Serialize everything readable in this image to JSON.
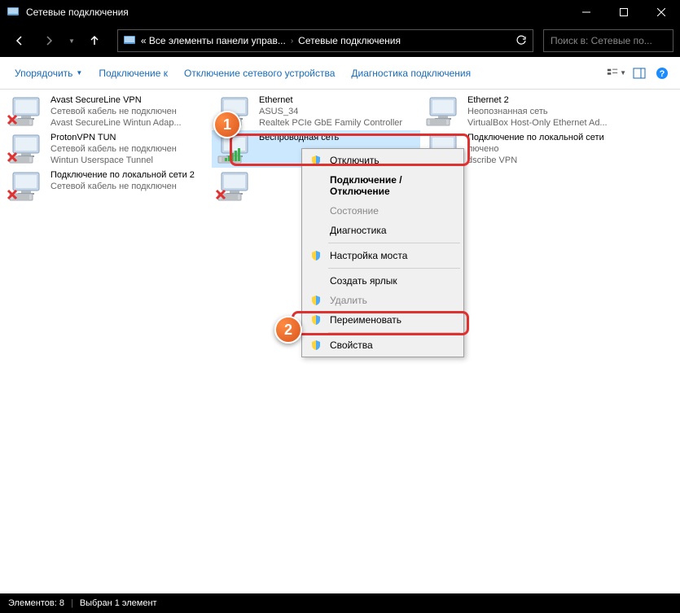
{
  "window": {
    "title": "Сетевые подключения"
  },
  "breadcrumb": {
    "part1": "« Все элементы панели управ...",
    "part2": "Сетевые подключения"
  },
  "search": {
    "placeholder": "Поиск в: Сетевые по..."
  },
  "toolbar": {
    "organize": "Упорядочить",
    "connect": "Подключение к",
    "disable": "Отключение сетевого устройства",
    "diagnose": "Диагностика подключения"
  },
  "connections": [
    {
      "name": "Avast SecureLine VPN",
      "status": "Сетевой кабель не подключен",
      "device": "Avast SecureLine Wintun Adap...",
      "x": true
    },
    {
      "name": "Ethernet",
      "status": "ASUS_34",
      "device": "Realtek PCIe GbE Family Controller",
      "x": false
    },
    {
      "name": "Ethernet 2",
      "status": "Неопознанная сеть",
      "device": "VirtualBox Host-Only Ethernet Ad...",
      "x": false
    },
    {
      "name": "ProtonVPN TUN",
      "status": "Сетевой кабель не подключен",
      "device": "Wintun Userspace Tunnel",
      "x": true
    },
    {
      "name": "Беспроводная сеть",
      "status": "",
      "device": "",
      "x": false,
      "selected": true,
      "signal": true
    },
    {
      "name": "Подключение по локальной сети",
      "status": "лючено",
      "device": "dscribe VPN",
      "x": false
    },
    {
      "name": "Подключение по локальной сети 2",
      "status": "Сетевой кабель не подключен",
      "device": "",
      "x": true
    },
    {
      "name": "",
      "status": "",
      "device": "",
      "x": true,
      "blank": true
    }
  ],
  "menu": {
    "disconnect": "Отключить",
    "connect_disconnect": "Подключение / Отключение",
    "status": "Состояние",
    "diagnostics": "Диагностика",
    "bridge": "Настройка моста",
    "shortcut": "Создать ярлык",
    "delete": "Удалить",
    "rename": "Переименовать",
    "properties": "Свойства"
  },
  "statusbar": {
    "items": "Элементов: 8",
    "selected": "Выбран 1 элемент"
  },
  "callouts": {
    "c1": "1",
    "c2": "2"
  }
}
